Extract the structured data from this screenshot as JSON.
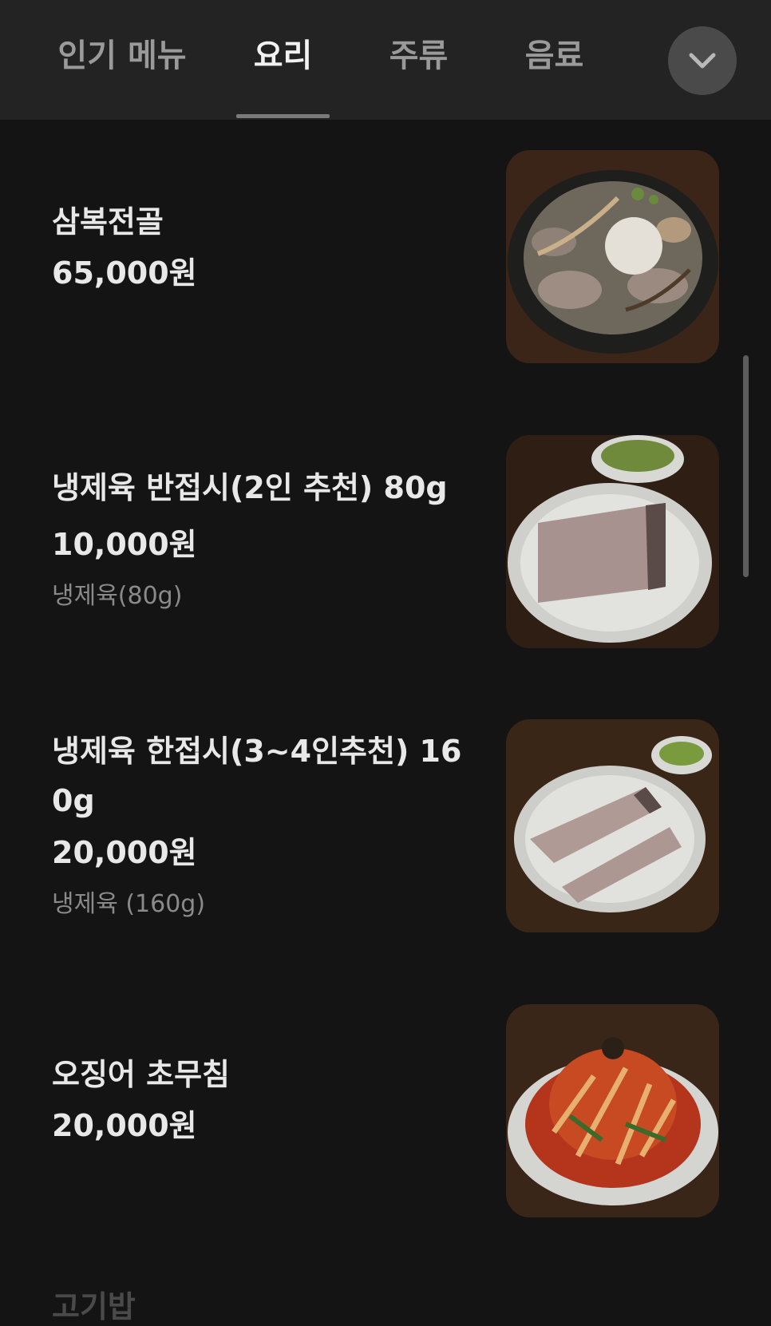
{
  "tabs": [
    {
      "label": "인기 메뉴",
      "active": false
    },
    {
      "label": "요리",
      "active": true
    },
    {
      "label": "주류",
      "active": false
    },
    {
      "label": "음료",
      "active": false
    }
  ],
  "more_button": {
    "icon": "chevron-down-icon"
  },
  "menu_items": [
    {
      "name": "삼복전골",
      "price": "65,000원",
      "desc": "",
      "photo_icon": "hotpot-photo"
    },
    {
      "name": "냉제육 반접시(2인 추천) 80g",
      "price": "10,000원",
      "desc": "냉제육(80g)",
      "photo_icon": "sliced-pork-half-plate-photo"
    },
    {
      "name": "냉제육 한접시(3~4인추천) 160g",
      "price": "20,000원",
      "desc": "냉제육 (160g)",
      "photo_icon": "sliced-pork-full-plate-photo"
    },
    {
      "name": "오징어 초무침",
      "price": "20,000원",
      "desc": "",
      "photo_icon": "squid-salad-photo"
    }
  ],
  "partial_next_item": {
    "name": "고기밥"
  }
}
